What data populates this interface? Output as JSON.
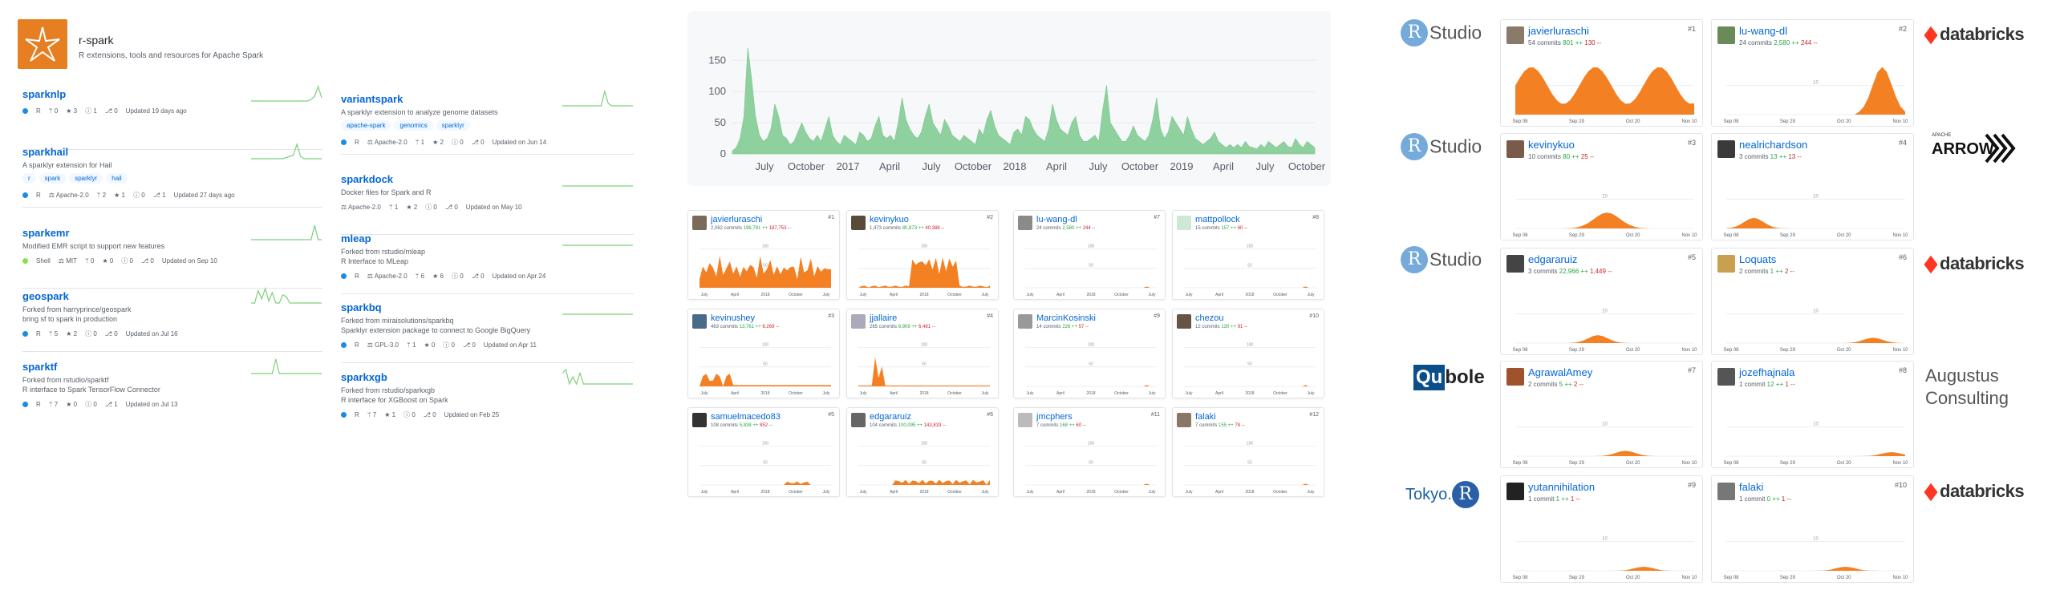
{
  "org": {
    "name": "r-spark",
    "description": "R extensions, tools and resources for Apache Spark"
  },
  "colors": {
    "link": "#0366d6",
    "spark_green": "#7cd07c",
    "area_green": "#8fd19e",
    "area_orange": "#f48024",
    "r_lang": "#198ce7",
    "shell_lang": "#89e051"
  },
  "repos_left": [
    {
      "name": "sparknlp",
      "description": "",
      "topics": [],
      "meta": [
        "R",
        "0",
        "3",
        "1",
        "0"
      ],
      "updated": "Updated 19 days ago",
      "lang": "R",
      "license": "",
      "spark": [
        0,
        0,
        0,
        0,
        0,
        0,
        0,
        0,
        0,
        0,
        0,
        0,
        0,
        0,
        0,
        0,
        0,
        1,
        3,
        9,
        2
      ]
    },
    {
      "name": "sparkhail",
      "description": "A sparklyr extension for Hail",
      "topics": [
        "r",
        "spark",
        "sparklyr",
        "hail"
      ],
      "meta": [
        "R",
        "Apache-2.0",
        "2",
        "1",
        "0",
        "1"
      ],
      "updated": "Updated 27 days ago",
      "lang": "R",
      "license": "Apache-2.0",
      "spark": [
        0,
        0,
        0,
        0,
        0,
        0,
        0,
        0,
        0,
        0,
        1,
        2,
        3,
        12,
        2,
        0,
        0,
        0,
        0,
        0,
        0
      ]
    },
    {
      "name": "sparkemr",
      "description": "Modified EMR script to support new features",
      "topics": [],
      "meta": [
        "Shell",
        "MIT",
        "0",
        "0",
        "0",
        "0"
      ],
      "updated": "Updated on Sep 10",
      "lang": "Shell",
      "license": "MIT",
      "spark": [
        0,
        0,
        0,
        0,
        0,
        0,
        0,
        0,
        0,
        0,
        0,
        0,
        0,
        0,
        0,
        0,
        0,
        0,
        1,
        0,
        0
      ]
    },
    {
      "name": "geospark",
      "description": "Forked from harryprince/geospark",
      "desc2": "bring sf to spark in production",
      "topics": [],
      "meta": [
        "R",
        "5",
        "2",
        "0",
        "0"
      ],
      "updated": "Updated on Jul 16",
      "lang": "R",
      "license": "",
      "spark": [
        0,
        0,
        6,
        2,
        7,
        1,
        5,
        0,
        0,
        4,
        3,
        0,
        0,
        0,
        0,
        0,
        0,
        0,
        0,
        0,
        0
      ]
    },
    {
      "name": "sparktf",
      "description": "Forked from rstudio/sparktf",
      "desc2": "R interface to Spark TensorFlow Connector",
      "topics": [],
      "meta": [
        "R",
        "7",
        "0",
        "0",
        "1"
      ],
      "updated": "Updated on Jul 13",
      "lang": "R",
      "license": "",
      "spark": [
        0,
        0,
        0,
        0,
        0,
        0,
        0,
        2,
        0,
        0,
        0,
        0,
        0,
        0,
        0,
        0,
        0,
        0,
        0,
        0,
        0
      ]
    }
  ],
  "repos_right": [
    {
      "name": "variantspark",
      "description": "A sparklyr extension to analyze genome datasets",
      "topics": [
        "apache-spark",
        "genomics",
        "sparklyr"
      ],
      "lang": "R",
      "license": "Apache-2.0",
      "meta": [
        "1",
        "2",
        "0",
        "0"
      ],
      "updated": "Updated on Jun 14",
      "spark": [
        0,
        0,
        0,
        0,
        0,
        0,
        0,
        0,
        0,
        0,
        0,
        0,
        6,
        1,
        0,
        0,
        0,
        0,
        0,
        0,
        0
      ]
    },
    {
      "name": "sparkdock",
      "description": "Docker files for Spark and R",
      "topics": [],
      "lang": "",
      "license": "Apache-2.0",
      "meta": [
        "1",
        "2",
        "0",
        "0"
      ],
      "updated": "Updated on May 10",
      "spark": [
        0,
        0,
        0,
        0,
        0,
        0,
        0,
        0,
        0,
        0,
        0,
        0,
        0,
        0,
        0,
        0,
        0,
        0,
        0,
        0,
        0
      ]
    },
    {
      "name": "mleap",
      "description": "Forked from rstudio/mleap",
      "desc2": "R Interface to MLeap",
      "topics": [],
      "lang": "R",
      "license": "Apache-2.0",
      "meta": [
        "6",
        "6",
        "0",
        "0"
      ],
      "updated": "Updated on Apr 24",
      "spark": [
        0,
        0,
        0,
        0,
        0,
        0,
        0,
        0,
        0,
        0,
        0,
        0,
        0,
        0,
        0,
        0,
        0,
        0,
        0,
        0,
        0
      ]
    },
    {
      "name": "sparkbq",
      "description": "Forked from miraisolutions/sparkbq",
      "desc2": "Sparklyr extension package to connect to Google BigQuery",
      "topics": [],
      "lang": "R",
      "license": "GPL-3.0",
      "meta": [
        "1",
        "0",
        "0",
        "0"
      ],
      "updated": "Updated on Apr 11",
      "spark": [
        0,
        0,
        0,
        0,
        0,
        0,
        0,
        0,
        0,
        0,
        0,
        0,
        0,
        0,
        0,
        0,
        0,
        0,
        0,
        0,
        0
      ]
    },
    {
      "name": "sparkxgb",
      "description": "Forked from rstudio/sparkxgb",
      "desc2": "R interface for XGBoost on Spark",
      "topics": [],
      "lang": "R",
      "license": "",
      "meta": [
        "7",
        "1",
        "0",
        "0"
      ],
      "updated": "Updated on Feb 25",
      "spark": [
        3,
        4,
        0,
        2,
        0,
        3,
        0,
        0,
        0,
        0,
        0,
        0,
        0,
        0,
        0,
        0,
        0,
        0,
        0,
        0,
        0
      ]
    }
  ],
  "main_chart": {
    "y_ticks": [
      "150",
      "100",
      "50",
      "0"
    ],
    "x_ticks": [
      "July",
      "October",
      "2017",
      "April",
      "July",
      "October",
      "2018",
      "April",
      "July",
      "October",
      "2019",
      "April",
      "July",
      "October"
    ],
    "values": [
      5,
      10,
      25,
      60,
      170,
      120,
      60,
      30,
      20,
      25,
      40,
      80,
      60,
      30,
      25,
      15,
      20,
      35,
      50,
      35,
      25,
      20,
      30,
      20,
      40,
      60,
      30,
      20,
      15,
      30,
      25,
      20,
      15,
      35,
      30,
      20,
      25,
      45,
      60,
      30,
      25,
      30,
      20,
      50,
      90,
      55,
      40,
      30,
      25,
      35,
      60,
      80,
      50,
      40,
      30,
      55,
      45,
      30,
      25,
      20,
      30,
      25,
      20,
      15,
      40,
      30,
      55,
      70,
      45,
      30,
      25,
      20,
      15,
      35,
      40,
      30,
      60,
      55,
      40,
      30,
      25,
      20,
      40,
      80,
      55,
      40,
      35,
      30,
      50,
      60,
      30,
      20,
      20,
      25,
      30,
      20,
      70,
      110,
      50,
      40,
      30,
      20,
      20,
      30,
      45,
      30,
      25,
      20,
      30,
      55,
      90,
      40,
      25,
      35,
      60,
      50,
      40,
      30,
      60,
      40,
      25,
      20,
      15,
      20,
      25,
      35,
      20,
      15,
      10,
      15,
      10,
      15,
      10,
      20,
      12,
      10,
      8,
      15,
      10,
      20,
      15,
      10,
      15,
      20,
      12,
      10,
      25,
      15,
      10,
      20,
      15,
      10
    ]
  },
  "contributors_mid": [
    {
      "name": "javierluraschi",
      "commits": "2,062 commits",
      "add": "196,781 ++",
      "del": "187,753 --",
      "rank": "#1",
      "x_ticks": [
        "July",
        "April",
        "2018",
        "October",
        "July"
      ],
      "y_ticks": [
        "100",
        "50"
      ]
    },
    {
      "name": "kevinykuo",
      "commits": "1,473 commits",
      "add": "80,873 ++",
      "del": "40,388 --",
      "rank": "#2",
      "x_ticks": [
        "July",
        "April",
        "2018",
        "October",
        "July"
      ],
      "y_ticks": [
        "100",
        "50"
      ]
    },
    {
      "name": "lu-wang-dl",
      "commits": "24 commits",
      "add": "2,580 ++",
      "del": "244 --",
      "rank": "#7",
      "x_ticks": [
        "July",
        "April",
        "2018",
        "October",
        "July"
      ],
      "y_ticks": [
        "100",
        "50"
      ]
    },
    {
      "name": "mattpollock",
      "commits": "15 commits",
      "add": "157 ++",
      "del": "60 --",
      "rank": "#8",
      "x_ticks": [
        "July",
        "April",
        "2018",
        "October",
        "July"
      ],
      "y_ticks": [
        "100",
        "50"
      ]
    },
    {
      "name": "kevinushey",
      "commits": "463 commits",
      "add": "13,761 ++",
      "del": "6,269 --",
      "rank": "#3",
      "x_ticks": [
        "July",
        "April",
        "2018",
        "October",
        "July"
      ],
      "y_ticks": [
        "100",
        "50"
      ]
    },
    {
      "name": "jjallaire",
      "commits": "265 commits",
      "add": "6,909 ++",
      "del": "6,481 --",
      "rank": "#4",
      "x_ticks": [
        "July",
        "April",
        "2018",
        "October",
        "July"
      ],
      "y_ticks": [
        "100",
        "50"
      ]
    },
    {
      "name": "MarcinKosinski",
      "commits": "14 commits",
      "add": "226 ++",
      "del": "57 --",
      "rank": "#9",
      "x_ticks": [
        "July",
        "April",
        "2018",
        "October",
        "July"
      ],
      "y_ticks": [
        "100",
        "50"
      ]
    },
    {
      "name": "chezou",
      "commits": "12 commits",
      "add": "130 ++",
      "del": "91 --",
      "rank": "#10",
      "x_ticks": [
        "July",
        "April",
        "2018",
        "October",
        "July"
      ],
      "y_ticks": [
        "100",
        "50"
      ]
    },
    {
      "name": "samuelmacedo83",
      "commits": "108 commits",
      "add": "5,838 ++",
      "del": "852 --",
      "rank": "#5",
      "x_ticks": [
        "July",
        "April",
        "2018",
        "October",
        "July"
      ],
      "y_ticks": [
        "100",
        "50"
      ]
    },
    {
      "name": "edgararuiz",
      "commits": "104 commits",
      "add": "100,095 ++",
      "del": "143,833 --",
      "rank": "#6",
      "x_ticks": [
        "July",
        "April",
        "2018",
        "October",
        "July"
      ],
      "y_ticks": [
        "100",
        "50"
      ]
    },
    {
      "name": "jmcphers",
      "commits": "7 commits",
      "add": "168 ++",
      "del": "60 --",
      "rank": "#11",
      "x_ticks": [
        "July",
        "April",
        "2018",
        "October",
        "July"
      ],
      "y_ticks": [
        "100",
        "50"
      ]
    },
    {
      "name": "falaki",
      "commits": "7 commits",
      "add": "155 ++",
      "del": "78 --",
      "rank": "#12",
      "x_ticks": [
        "July",
        "April",
        "2018",
        "October",
        "July"
      ],
      "y_ticks": [
        "100",
        "50"
      ]
    }
  ],
  "contributors_right": [
    {
      "name": "javierluraschi",
      "commits": "54 commits",
      "add": "801 ++",
      "del": "130 --",
      "rank": "#1",
      "x_ticks": [
        "Sep 08",
        "Sep 29",
        "Oct 20",
        "Nov 10"
      ],
      "y_ticks": [
        "10"
      ],
      "logo": "rstudio"
    },
    {
      "name": "lu-wang-dl",
      "commits": "24 commits",
      "add": "2,580 ++",
      "del": "244 --",
      "rank": "#2",
      "x_ticks": [
        "Sep 08",
        "Sep 29",
        "Oct 20",
        "Nov 10"
      ],
      "y_ticks": [
        "10"
      ],
      "logo": "databricks"
    },
    {
      "name": "kevinykuo",
      "commits": "10 commits",
      "add": "80 ++",
      "del": "25 --",
      "rank": "#3",
      "x_ticks": [
        "Sep 08",
        "Sep 29",
        "Oct 20",
        "Nov 10"
      ],
      "y_ticks": [
        "10"
      ],
      "logo": "rstudio"
    },
    {
      "name": "nealrichardson",
      "commits": "3 commits",
      "add": "13 ++",
      "del": "13 --",
      "rank": "#4",
      "x_ticks": [
        "Sep 08",
        "Sep 29",
        "Oct 20",
        "Nov 10"
      ],
      "y_ticks": [
        "10"
      ],
      "logo": "arrow"
    },
    {
      "name": "edgararuiz",
      "commits": "3 commits",
      "add": "22,966 ++",
      "del": "1,449 --",
      "rank": "#5",
      "x_ticks": [
        "Sep 08",
        "Sep 29",
        "Oct 20",
        "Nov 10"
      ],
      "y_ticks": [
        "10"
      ],
      "logo": "rstudio"
    },
    {
      "name": "Loquats",
      "commits": "2 commits",
      "add": "1 ++",
      "del": "2 --",
      "rank": "#6",
      "x_ticks": [
        "Sep 08",
        "Sep 29",
        "Oct 20",
        "Nov 10"
      ],
      "y_ticks": [
        "10"
      ],
      "logo": "databricks"
    },
    {
      "name": "AgrawalAmey",
      "commits": "2 commits",
      "add": "5 ++",
      "del": "2 --",
      "rank": "#7",
      "x_ticks": [
        "Sep 08",
        "Sep 29",
        "Oct 20",
        "Nov 10"
      ],
      "y_ticks": [
        "10"
      ],
      "logo": "qubole"
    },
    {
      "name": "jozefhajnala",
      "commits": "1 commit",
      "add": "12 ++",
      "del": "1 --",
      "rank": "#8",
      "x_ticks": [
        "Sep 08",
        "Sep 29",
        "Oct 20",
        "Nov 10"
      ],
      "y_ticks": [
        "10"
      ],
      "logo": "augustus"
    },
    {
      "name": "yutannihilation",
      "commits": "1 commit",
      "add": "1 ++",
      "del": "1 --",
      "rank": "#9",
      "x_ticks": [
        "Sep 08",
        "Sep 29",
        "Oct 20",
        "Nov 10"
      ],
      "y_ticks": [
        "10"
      ],
      "logo": "tokyor"
    },
    {
      "name": "falaki",
      "commits": "1 commit",
      "add": "0 ++",
      "del": "1 --",
      "rank": "#10",
      "x_ticks": [
        "Sep 08",
        "Sep 29",
        "Oct 20",
        "Nov 10"
      ],
      "y_ticks": [
        "10"
      ],
      "logo": "databricks"
    }
  ],
  "logos": {
    "rstudio_letter": "R",
    "rstudio_text": "Studio",
    "databricks_text": "databricks",
    "arrow_small": "APACHE",
    "arrow_text": "ARROW",
    "qubole_box": "Qu",
    "qubole_text": "bole",
    "augustus_text": "Augustus Consulting",
    "tokyor_text": "Tokyo.",
    "tokyor_r": "R"
  }
}
